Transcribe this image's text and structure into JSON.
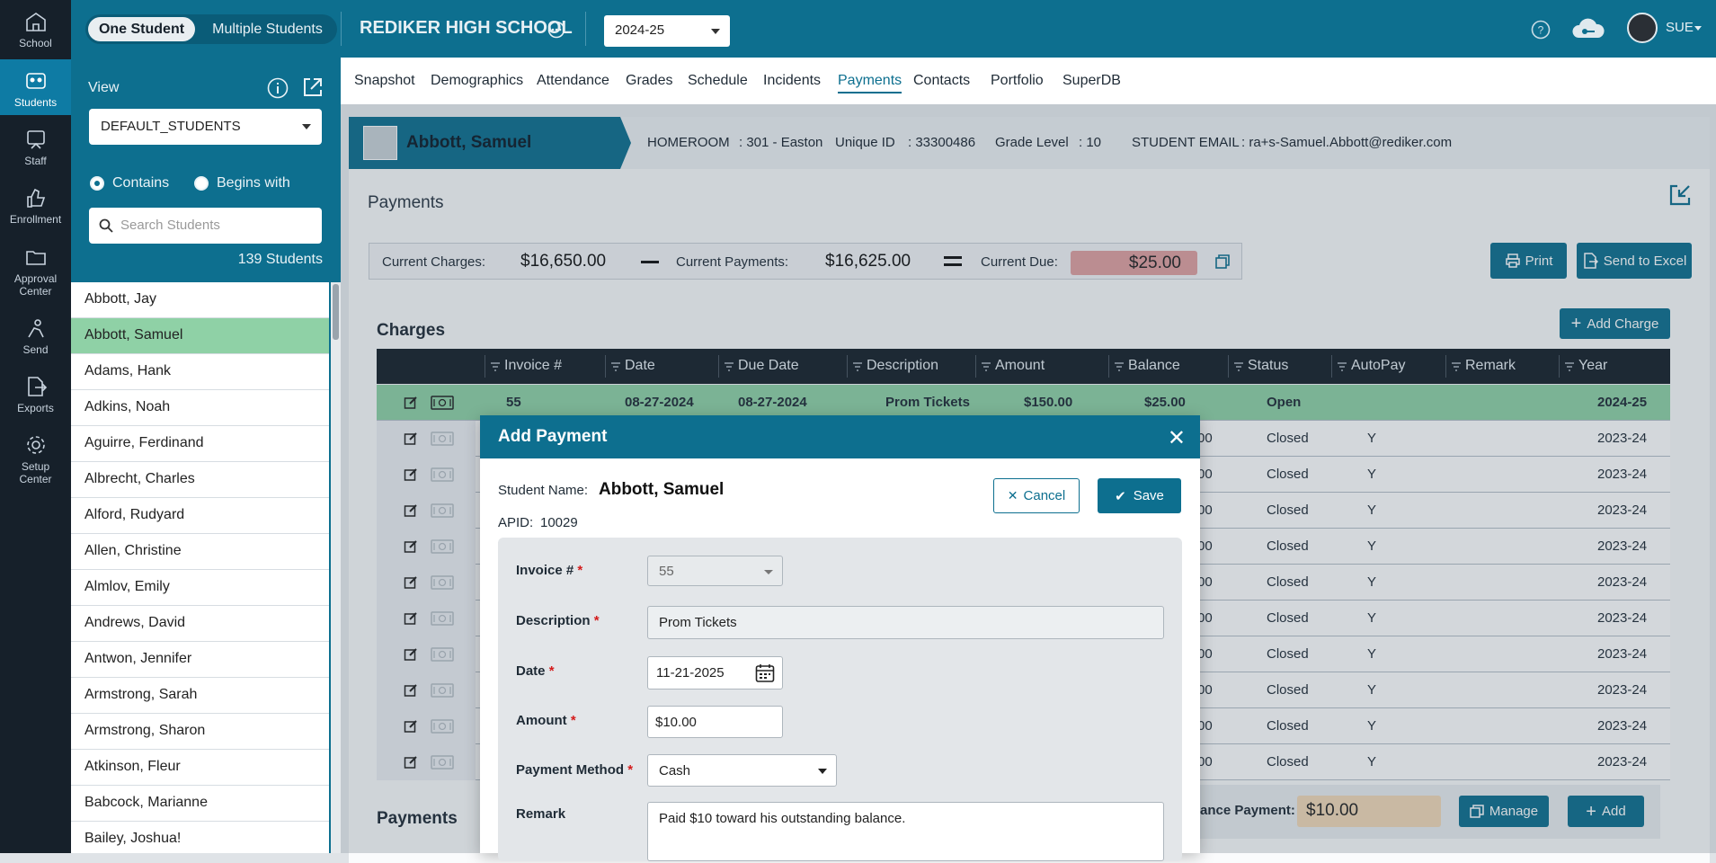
{
  "nav": {
    "items": [
      {
        "label": "School",
        "icon": "school-icon"
      },
      {
        "label": "Students",
        "icon": "students-icon"
      },
      {
        "label": "Staff",
        "icon": "staff-icon"
      },
      {
        "label": "Enrollment",
        "icon": "enrollment-icon"
      },
      {
        "label": "Approval Center",
        "icon": "approval-icon"
      },
      {
        "label": "Send",
        "icon": "send-icon"
      },
      {
        "label": "Exports",
        "icon": "exports-icon"
      },
      {
        "label": "Setup Center",
        "icon": "setup-icon"
      }
    ]
  },
  "topbar": {
    "one_student": "One Student",
    "multiple_students": "Multiple Students",
    "school_name": "REDIKER HIGH SCHOOL",
    "year": "2024-25",
    "user": "SUE"
  },
  "sidebar": {
    "view_label": "View",
    "view_value": "DEFAULT_STUDENTS",
    "contains": "Contains",
    "begins_with": "Begins with",
    "search_placeholder": "Search Students",
    "count": "139 Students",
    "students": [
      "Abbott, Jay",
      "Abbott, Samuel",
      "Adams, Hank",
      "Adkins, Noah",
      "Aguirre, Ferdinand",
      "Albrecht, Charles",
      "Alford, Rudyard",
      "Allen, Christine",
      "Almlov, Emily",
      "Andrews, David",
      "Antwon, Jennifer",
      "Armstrong, Sarah",
      "Armstrong, Sharon",
      "Atkinson, Fleur",
      "Babcock, Marianne",
      "Bailey, Joshua!"
    ],
    "selected": "Abbott, Samuel"
  },
  "tabs": [
    "Snapshot",
    "Demographics",
    "Attendance",
    "Grades",
    "Schedule",
    "Incidents",
    "Payments",
    "Contacts",
    "Portfolio",
    "SuperDB"
  ],
  "active_tab": "Payments",
  "student": {
    "name": "Abbott, Samuel",
    "homeroom_label": "HOMEROOM",
    "homeroom": ": 301 - Easton",
    "uid_label": "Unique ID",
    "uid": ": 33300486",
    "grade_label": "Grade Level",
    "grade": ": 10",
    "email_label": "STUDENT EMAIL",
    "email": ": ra+s-Samuel.Abbott@rediker.com"
  },
  "payments": {
    "title": "Payments",
    "current_charges_label": "Current Charges:",
    "current_charges": "$16,650.00",
    "current_payments_label": "Current Payments:",
    "current_payments": "$16,625.00",
    "current_due_label": "Current Due:",
    "current_due": "$25.00",
    "print": "Print",
    "send_excel": "Send to Excel",
    "charges_title": "Charges",
    "add_charge": "Add Charge",
    "payments_section": "Payments",
    "balance_payment_label": "ance Payment:",
    "balance_payment": "$10.00",
    "manage": "Manage",
    "add": "Add"
  },
  "grid": {
    "headers": [
      "Invoice #",
      "Date",
      "Due Date",
      "Description",
      "Amount",
      "Balance",
      "Status",
      "AutoPay",
      "Remark",
      "Year"
    ],
    "rows": [
      {
        "invoice": "55",
        "date": "08-27-2024",
        "due": "08-27-2024",
        "desc": "Prom Tickets",
        "amount": "$150.00",
        "balance": "$25.00",
        "status": "Open",
        "autopay": "",
        "year": "2024-25"
      },
      {
        "balance": "00",
        "status": "Closed",
        "autopay": "Y",
        "year": "2023-24"
      },
      {
        "balance": "00",
        "status": "Closed",
        "autopay": "Y",
        "year": "2023-24"
      },
      {
        "balance": "00",
        "status": "Closed",
        "autopay": "Y",
        "year": "2023-24"
      },
      {
        "balance": "00",
        "status": "Closed",
        "autopay": "Y",
        "year": "2023-24"
      },
      {
        "balance": "00",
        "status": "Closed",
        "autopay": "Y",
        "year": "2023-24"
      },
      {
        "balance": "00",
        "status": "Closed",
        "autopay": "Y",
        "year": "2023-24"
      },
      {
        "balance": "00",
        "status": "Closed",
        "autopay": "Y",
        "year": "2023-24"
      },
      {
        "balance": "00",
        "status": "Closed",
        "autopay": "Y",
        "year": "2023-24"
      },
      {
        "balance": "00",
        "status": "Closed",
        "autopay": "Y",
        "year": "2023-24"
      },
      {
        "balance": "00",
        "status": "Closed",
        "autopay": "Y",
        "year": "2023-24"
      }
    ]
  },
  "modal": {
    "title": "Add Payment",
    "student_name_label": "Student Name:",
    "student_name": "Abbott, Samuel",
    "apid_label": "APID:",
    "apid": "10029",
    "cancel": "Cancel",
    "save": "Save",
    "invoice_label": "Invoice #",
    "invoice": "55",
    "description_label": "Description",
    "description": "Prom Tickets",
    "date_label": "Date",
    "date": "11-21-2025",
    "amount_label": "Amount",
    "amount": "$10.00",
    "method_label": "Payment Method",
    "method": "Cash",
    "remark_label": "Remark",
    "remark": "Paid $10 toward his outstanding balance.",
    "required_mark": "*"
  },
  "colors": {
    "primary": "#0d6f8f",
    "nav_bg": "#16202a",
    "highlight_row": "#8fd1a6",
    "due_bg": "#e0a1a1"
  }
}
